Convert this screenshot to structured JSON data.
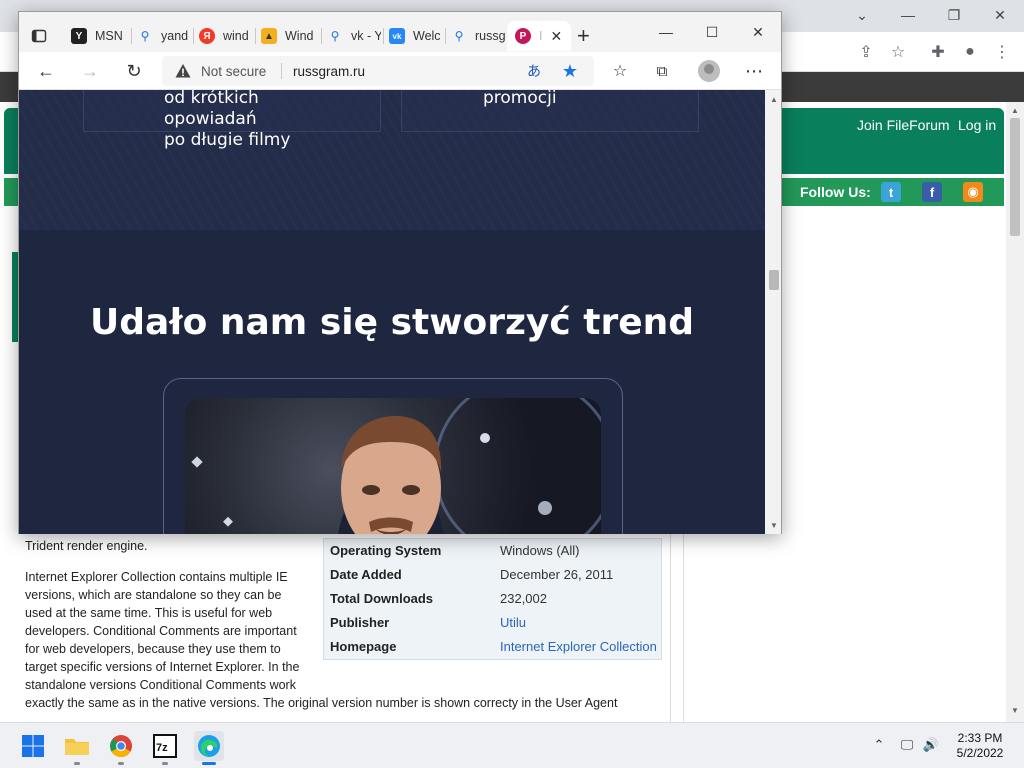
{
  "background_window": {
    "header_links": [
      "Join FileForum",
      "Log in"
    ],
    "follow_label": "Follow Us:",
    "social": [
      {
        "name": "twitter-icon",
        "glyph": "t",
        "color": "#3aa3d8"
      },
      {
        "name": "facebook-icon",
        "glyph": "f",
        "color": "#3a5da8"
      },
      {
        "name": "rss-icon",
        "glyph": "◉",
        "color": "#f08a1c"
      }
    ],
    "description": {
      "line_top": "Trident render engine.",
      "paragraph_lines": [
        "Internet Explorer Collection contains multiple IE",
        "versions, which are standalone so they can be",
        "used at the same time. This is useful for web",
        "developers. Conditional Comments are important",
        "for web developers, because they use them to",
        "target specific versions of Internet Explorer. In the",
        "standalone versions Conditional Comments work"
      ],
      "paragraph_wide": "exactly the same as in the native versions. The original version number is shown correcty in the User Agent"
    },
    "info_table": [
      {
        "key": "Operating System",
        "value": "Windows (All)",
        "link": false
      },
      {
        "key": "Date Added",
        "value": "December 26, 2011",
        "link": false
      },
      {
        "key": "Total Downloads",
        "value": "232,002",
        "link": false
      },
      {
        "key": "Publisher",
        "value": "Utilu",
        "link": true
      },
      {
        "key": "Homepage",
        "value": "Internet Explorer Collection",
        "link": true
      }
    ]
  },
  "edge": {
    "tabs": [
      {
        "label": "MSN",
        "icon": "msn-icon",
        "color": "#222222",
        "glyph": "Y"
      },
      {
        "label": "yand",
        "icon": "search-icon",
        "color": "#ffffff",
        "glyph": "🔍"
      },
      {
        "label": "wind",
        "icon": "yandex-icon",
        "color": "#f33a2a",
        "glyph": "Я"
      },
      {
        "label": "Wind",
        "icon": "mountain-icon",
        "color": "#f2b01e",
        "glyph": "▲"
      },
      {
        "label": "vk - Y",
        "icon": "search-icon",
        "color": "#ffffff",
        "glyph": "🔍"
      },
      {
        "label": "Welc",
        "icon": "vk-icon",
        "color": "#2787f5",
        "glyph": "vk"
      },
      {
        "label": "russg",
        "icon": "search-icon",
        "color": "#ffffff",
        "glyph": "🔍"
      }
    ],
    "active_tab": {
      "label": "I",
      "icon": "russgram-icon",
      "color": "#c2185b"
    },
    "address": {
      "security": "Not secure",
      "url": "russgram.ru"
    }
  },
  "page": {
    "hero_left_lines": [
      "od krótkich",
      "opowiadań",
      "po długie filmy"
    ],
    "hero_right_lines": [
      "promocji"
    ],
    "section_title": "Udało nam się stworzyć trend"
  },
  "taskbar": {
    "time": "2:33 PM",
    "date": "5/2/2022"
  }
}
